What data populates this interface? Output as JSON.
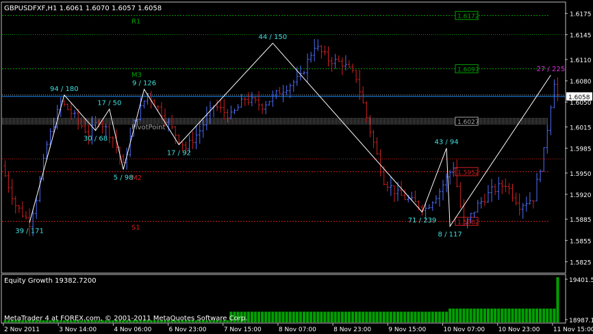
{
  "header": {
    "symbol_label": "GBPUSDFXF,H1  1.6061 1.6070 1.6057 1.6058"
  },
  "indicator": {
    "title": "Equity Growth 19382.7200"
  },
  "footer": {
    "copyright": "MetaTrader 4 at FOREX.com, © 2001-2011 MetaQuotes Software Corp."
  },
  "colors": {
    "background": "#000000",
    "axis": "#c0c0c0",
    "bull": "#4f6fff",
    "bear": "#d02020",
    "zigzag": "#ffffff",
    "label_cyan": "#40e0e0",
    "label_magenta": "#e030e0",
    "green": "#00a000",
    "red_level": "#d02020",
    "price_line": "#1e90ff",
    "gray_level": "#a0a0a0"
  },
  "chart_data": [
    {
      "type": "candlestick",
      "title": "GBPUSDFXF,H1  1.6061 1.6070 1.6057 1.6058",
      "ylim": [
        1.581,
        1.619
      ],
      "y_ticks": [
        "1.6175",
        "1.6145",
        "1.6110",
        "1.6080",
        "1.6050",
        "1.6015",
        "1.5985",
        "1.5950",
        "1.5920",
        "1.5885",
        "1.5855",
        "1.5825"
      ],
      "y_tick_values": [
        1.6175,
        1.6145,
        1.611,
        1.608,
        1.605,
        1.6015,
        1.5985,
        1.595,
        1.592,
        1.5885,
        1.5855,
        1.5825
      ],
      "x_ticks": [
        "2 Nov 2011",
        "3 Nov 14:00",
        "4 Nov 06:00",
        "6 Nov 23:00",
        "7 Nov 15:00",
        "8 Nov 07:00",
        "8 Nov 23:00",
        "9 Nov 15:00",
        "10 Nov 07:00",
        "10 Nov 23:00",
        "11 Nov 15:00"
      ],
      "bar_count": 160,
      "price_anchor_path": [
        [
          0,
          1.596
        ],
        [
          4,
          1.5905
        ],
        [
          8,
          1.588
        ],
        [
          10,
          1.5915
        ],
        [
          13,
          1.599
        ],
        [
          17,
          1.605
        ],
        [
          20,
          1.6035
        ],
        [
          25,
          1.6005
        ],
        [
          28,
          1.6025
        ],
        [
          32,
          1.6
        ],
        [
          35,
          1.596
        ],
        [
          38,
          1.602
        ],
        [
          42,
          1.6062
        ],
        [
          46,
          1.6035
        ],
        [
          50,
          1.6005
        ],
        [
          53,
          1.5985
        ],
        [
          57,
          1.601
        ],
        [
          61,
          1.6045
        ],
        [
          66,
          1.603
        ],
        [
          70,
          1.6055
        ],
        [
          75,
          1.6045
        ],
        [
          80,
          1.6065
        ],
        [
          86,
          1.6085
        ],
        [
          90,
          1.613
        ],
        [
          94,
          1.611
        ],
        [
          98,
          1.6105
        ],
        [
          102,
          1.6085
        ],
        [
          106,
          1.601
        ],
        [
          110,
          1.594
        ],
        [
          114,
          1.592
        ],
        [
          118,
          1.591
        ],
        [
          122,
          1.59
        ],
        [
          126,
          1.5925
        ],
        [
          130,
          1.596
        ],
        [
          133,
          1.5875
        ],
        [
          137,
          1.5905
        ],
        [
          141,
          1.5925
        ],
        [
          145,
          1.5935
        ],
        [
          149,
          1.5905
        ],
        [
          153,
          1.5915
        ],
        [
          156,
          1.598
        ],
        [
          159,
          1.608
        ],
        [
          160,
          1.606
        ]
      ],
      "last_price": 1.6058,
      "current_price_label": "1.6058",
      "levels": [
        {
          "name": "R1",
          "value": 1.6172,
          "price_label": "1.6172",
          "color": "#00a000",
          "style": "dotted"
        },
        {
          "name": "M3",
          "value": 1.6097,
          "price_label": "1.6097",
          "color": "#00a000",
          "style": "dotted"
        },
        {
          "name": "PivotPoint",
          "value": 1.6023,
          "price_label": "1.6027",
          "color": "#a0a0a0",
          "style": "dotted-band"
        },
        {
          "name": "M2",
          "value": 1.5952,
          "price_label": "1.5952",
          "color": "#d02020",
          "style": "dotted"
        },
        {
          "name": "S1",
          "value": 1.5882,
          "price_label": "1.5882",
          "color": "#d02020",
          "style": "dotted"
        }
      ],
      "extra_levels": [
        1.6145,
        1.597,
        1.606
      ],
      "zigzag_points": [
        {
          "bar": 7,
          "price": 1.588,
          "label": "39 / 171",
          "placement": "below"
        },
        {
          "bar": 17,
          "price": 1.606,
          "label": "94 / 180",
          "placement": "above"
        },
        {
          "bar": 26,
          "price": 1.601,
          "label": "30 / 68",
          "placement": "below"
        },
        {
          "bar": 30,
          "price": 1.604,
          "label": "17 / 50",
          "placement": "above"
        },
        {
          "bar": 34,
          "price": 1.5955,
          "label": "5 / 98",
          "placement": "below"
        },
        {
          "bar": 40,
          "price": 1.6068,
          "label": "9 / 126",
          "placement": "above"
        },
        {
          "bar": 50,
          "price": 1.599,
          "label": "17 / 92",
          "placement": "below"
        },
        {
          "bar": 77,
          "price": 1.6133,
          "label": "44 / 150",
          "placement": "above"
        },
        {
          "bar": 120,
          "price": 1.5895,
          "label": "71 / 239",
          "placement": "below"
        },
        {
          "bar": 127,
          "price": 1.5985,
          "label": "43 / 94",
          "placement": "above"
        },
        {
          "bar": 128,
          "price": 1.5875,
          "label": "8 / 117",
          "placement": "below"
        },
        {
          "bar": 157,
          "price": 1.6088,
          "label": "27 / 225",
          "placement": "above",
          "color": "#e030e0"
        }
      ]
    },
    {
      "type": "bar",
      "title": "Equity Growth 19382.7200",
      "ylim": [
        18987.1,
        19401.5
      ],
      "y_ticks": [
        "19401.5",
        "18987.1"
      ],
      "y_tick_values": [
        19401.5,
        18987.1
      ],
      "steps": [
        {
          "start_bar": 0,
          "end_bar": 65,
          "value": 18987.1
        },
        {
          "start_bar": 65,
          "end_bar": 128,
          "value": 19070
        },
        {
          "start_bar": 128,
          "end_bar": 159,
          "value": 19100
        },
        {
          "start_bar": 159,
          "end_bar": 160,
          "value": 19401.5
        }
      ]
    }
  ]
}
